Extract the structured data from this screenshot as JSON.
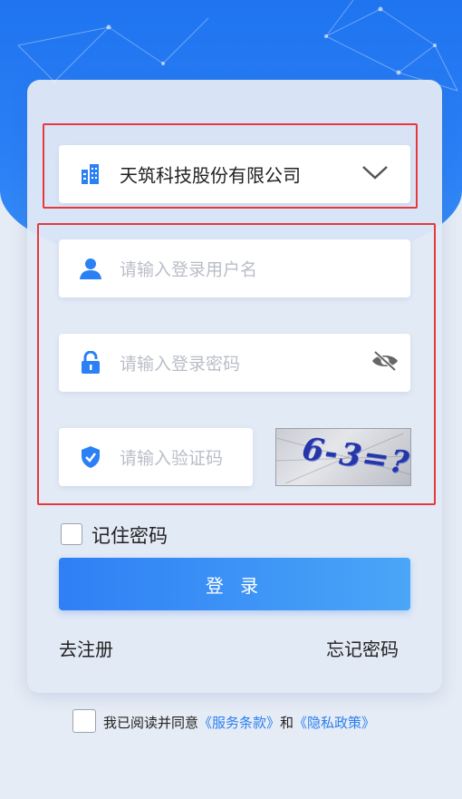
{
  "company": {
    "name": "天筑科技股份有限公司"
  },
  "username": {
    "placeholder": "请输入登录用户名"
  },
  "password": {
    "placeholder": "请输入登录密码"
  },
  "captcha": {
    "placeholder": "请输入验证码",
    "image_text": "6-3=?"
  },
  "remember": {
    "label": "记住密码"
  },
  "login": {
    "label": "登 录"
  },
  "links": {
    "register": "去注册",
    "forgot": "忘记密码"
  },
  "agreement": {
    "prefix": "我已阅读并同意",
    "terms": "《服务条款》",
    "and": "和",
    "privacy": "《隐私政策》"
  },
  "colors": {
    "primary": "#2b80f5",
    "highlight": "#e8383d",
    "link": "#2b7ff0"
  },
  "icons": {
    "company": "building-icon",
    "user": "user-icon",
    "lock": "lock-icon",
    "shield": "shield-check-icon",
    "eye": "eye-slash-icon",
    "chevron": "chevron-down-icon"
  }
}
